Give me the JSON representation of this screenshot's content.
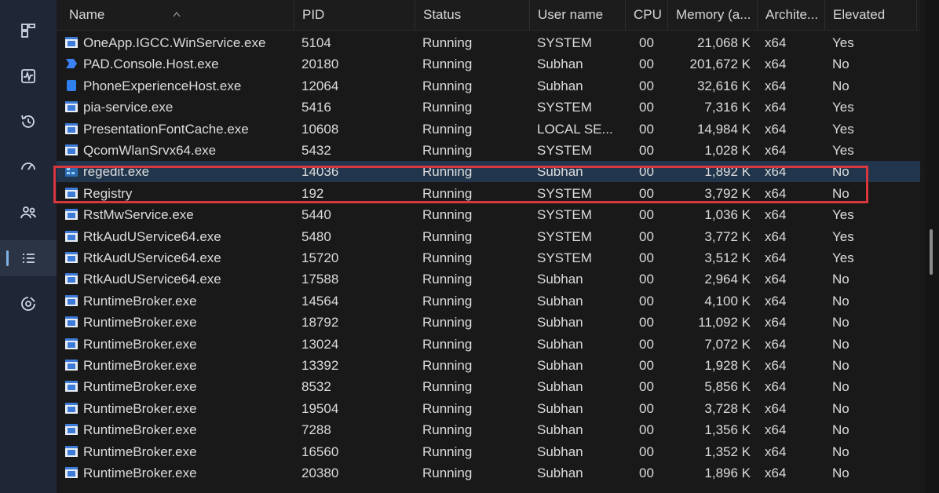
{
  "sidebar": {
    "items": [
      {
        "name": "processes-icon"
      },
      {
        "name": "performance-icon"
      },
      {
        "name": "app-history-icon"
      },
      {
        "name": "startup-apps-icon"
      },
      {
        "name": "users-icon"
      },
      {
        "name": "details-icon",
        "active": true
      },
      {
        "name": "services-icon"
      }
    ]
  },
  "table": {
    "columns": [
      "Name",
      "PID",
      "Status",
      "User name",
      "CPU",
      "Memory (a...",
      "Archite...",
      "Elevated"
    ],
    "sorted_column": "Name",
    "rows": [
      {
        "name": "OneApp.IGCC.WinService.exe",
        "pid": "5104",
        "status": "Running",
        "user": "SYSTEM",
        "cpu": "00",
        "memory": "21,068 K",
        "arch": "x64",
        "elevated": "Yes",
        "icon": "app-window-icon"
      },
      {
        "name": "PAD.Console.Host.exe",
        "pid": "20180",
        "status": "Running",
        "user": "Subhan",
        "cpu": "00",
        "memory": "201,672 K",
        "arch": "x64",
        "elevated": "No",
        "icon": "power-automate-icon"
      },
      {
        "name": "PhoneExperienceHost.exe",
        "pid": "12064",
        "status": "Running",
        "user": "Subhan",
        "cpu": "00",
        "memory": "32,616 K",
        "arch": "x64",
        "elevated": "No",
        "icon": "phone-link-icon"
      },
      {
        "name": "pia-service.exe",
        "pid": "5416",
        "status": "Running",
        "user": "SYSTEM",
        "cpu": "00",
        "memory": "7,316 K",
        "arch": "x64",
        "elevated": "Yes",
        "icon": "app-window-icon"
      },
      {
        "name": "PresentationFontCache.exe",
        "pid": "10608",
        "status": "Running",
        "user": "LOCAL SE...",
        "cpu": "00",
        "memory": "14,984 K",
        "arch": "x64",
        "elevated": "Yes",
        "icon": "app-window-icon"
      },
      {
        "name": "QcomWlanSrvx64.exe",
        "pid": "5432",
        "status": "Running",
        "user": "SYSTEM",
        "cpu": "00",
        "memory": "1,028 K",
        "arch": "x64",
        "elevated": "Yes",
        "icon": "app-window-icon"
      },
      {
        "name": "regedit.exe",
        "pid": "14036",
        "status": "Running",
        "user": "Subhan",
        "cpu": "00",
        "memory": "1,892 K",
        "arch": "x64",
        "elevated": "No",
        "icon": "registry-editor-icon",
        "selected": true
      },
      {
        "name": "Registry",
        "pid": "192",
        "status": "Running",
        "user": "SYSTEM",
        "cpu": "00",
        "memory": "3,792 K",
        "arch": "x64",
        "elevated": "No",
        "icon": "app-window-icon"
      },
      {
        "name": "RstMwService.exe",
        "pid": "5440",
        "status": "Running",
        "user": "SYSTEM",
        "cpu": "00",
        "memory": "1,036 K",
        "arch": "x64",
        "elevated": "Yes",
        "icon": "app-window-icon"
      },
      {
        "name": "RtkAudUService64.exe",
        "pid": "5480",
        "status": "Running",
        "user": "SYSTEM",
        "cpu": "00",
        "memory": "3,772 K",
        "arch": "x64",
        "elevated": "Yes",
        "icon": "app-window-icon"
      },
      {
        "name": "RtkAudUService64.exe",
        "pid": "15720",
        "status": "Running",
        "user": "SYSTEM",
        "cpu": "00",
        "memory": "3,512 K",
        "arch": "x64",
        "elevated": "Yes",
        "icon": "app-window-icon"
      },
      {
        "name": "RtkAudUService64.exe",
        "pid": "17588",
        "status": "Running",
        "user": "Subhan",
        "cpu": "00",
        "memory": "2,964 K",
        "arch": "x64",
        "elevated": "No",
        "icon": "app-window-icon"
      },
      {
        "name": "RuntimeBroker.exe",
        "pid": "14564",
        "status": "Running",
        "user": "Subhan",
        "cpu": "00",
        "memory": "4,100 K",
        "arch": "x64",
        "elevated": "No",
        "icon": "app-window-icon"
      },
      {
        "name": "RuntimeBroker.exe",
        "pid": "18792",
        "status": "Running",
        "user": "Subhan",
        "cpu": "00",
        "memory": "11,092 K",
        "arch": "x64",
        "elevated": "No",
        "icon": "app-window-icon"
      },
      {
        "name": "RuntimeBroker.exe",
        "pid": "13024",
        "status": "Running",
        "user": "Subhan",
        "cpu": "00",
        "memory": "7,072 K",
        "arch": "x64",
        "elevated": "No",
        "icon": "app-window-icon"
      },
      {
        "name": "RuntimeBroker.exe",
        "pid": "13392",
        "status": "Running",
        "user": "Subhan",
        "cpu": "00",
        "memory": "1,928 K",
        "arch": "x64",
        "elevated": "No",
        "icon": "app-window-icon"
      },
      {
        "name": "RuntimeBroker.exe",
        "pid": "8532",
        "status": "Running",
        "user": "Subhan",
        "cpu": "00",
        "memory": "5,856 K",
        "arch": "x64",
        "elevated": "No",
        "icon": "app-window-icon"
      },
      {
        "name": "RuntimeBroker.exe",
        "pid": "19504",
        "status": "Running",
        "user": "Subhan",
        "cpu": "00",
        "memory": "3,728 K",
        "arch": "x64",
        "elevated": "No",
        "icon": "app-window-icon"
      },
      {
        "name": "RuntimeBroker.exe",
        "pid": "7288",
        "status": "Running",
        "user": "Subhan",
        "cpu": "00",
        "memory": "1,356 K",
        "arch": "x64",
        "elevated": "No",
        "icon": "app-window-icon"
      },
      {
        "name": "RuntimeBroker.exe",
        "pid": "16560",
        "status": "Running",
        "user": "Subhan",
        "cpu": "00",
        "memory": "1,352 K",
        "arch": "x64",
        "elevated": "No",
        "icon": "app-window-icon"
      },
      {
        "name": "RuntimeBroker.exe",
        "pid": "20380",
        "status": "Running",
        "user": "Subhan",
        "cpu": "00",
        "memory": "1,896 K",
        "arch": "x64",
        "elevated": "No",
        "icon": "app-window-icon"
      }
    ]
  },
  "colors": {
    "sidebar_bg": "#1f2635",
    "table_bg": "#191919",
    "selected_row": "#21364d",
    "highlight_border": "#d9363e",
    "accent": "#7fb3e6"
  }
}
